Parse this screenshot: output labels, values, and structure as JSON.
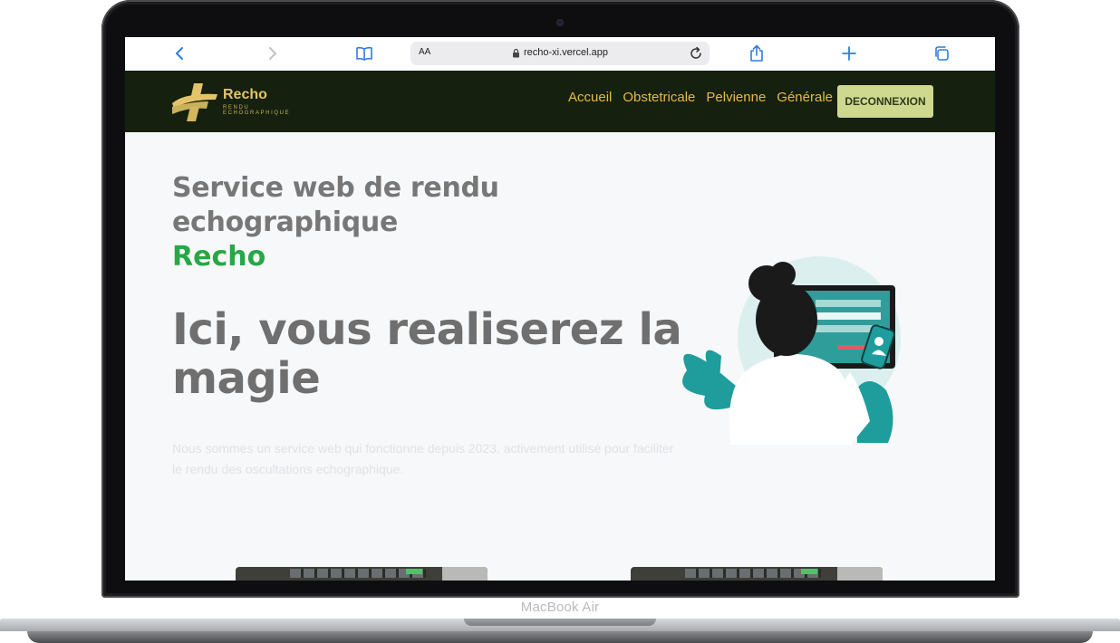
{
  "device": {
    "label": "MacBook Air"
  },
  "browser": {
    "reader_label": "AA",
    "url": "recho-xi.vercel.app"
  },
  "site": {
    "logo": {
      "name": "Recho",
      "tagline": "RENDU ECHOGRAPHIQUE"
    },
    "nav": {
      "links": [
        "Accueil",
        "Obstetricale",
        "Pelvienne",
        "Générale"
      ],
      "logout_label": "DECONNEXION"
    },
    "hero": {
      "title": "Service web de rendu echographique",
      "brand": "Recho",
      "tagline": "Ici, vous realiserez la magie",
      "description": "Nous sommes un service web qui fonctionne depuis 2023, activement utilisé pour faciliter le rendu des oscultations echographique."
    }
  },
  "colors": {
    "nav_bg": "#15200f",
    "nav_link": "#e9b84a",
    "logout_bg": "#cfd88f",
    "brand_green": "#28a745",
    "heading_gray": "#777777",
    "accent_teal": "#1f9c9c"
  }
}
